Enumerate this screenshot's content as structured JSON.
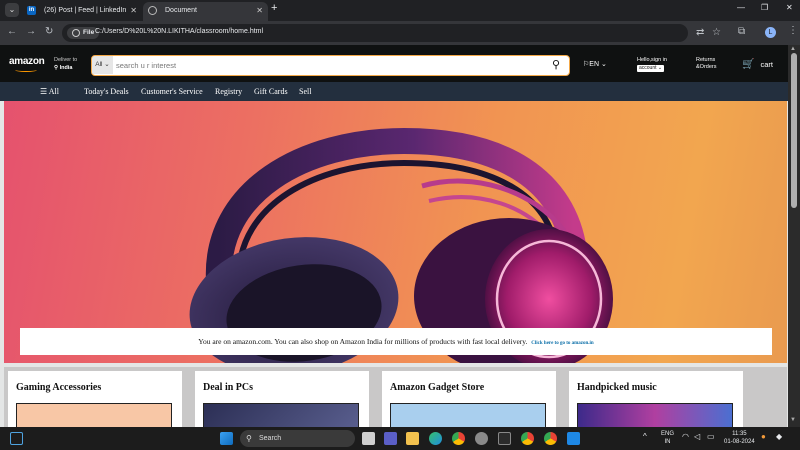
{
  "browser": {
    "tabs": [
      {
        "label": "(26) Post | Feed | LinkedIn",
        "favicon": "linkedin-icon"
      },
      {
        "label": "Document",
        "favicon": "globe-icon",
        "active": true
      }
    ],
    "omnibox": {
      "scheme": "File",
      "url": "C:/Users/D%20L%20N.LIKITHA/classroom/home.html"
    },
    "profile_initial": "L"
  },
  "amazon": {
    "logo": "amazon",
    "deliver": {
      "line1": "Deliver to",
      "line2": "India"
    },
    "search": {
      "category": "All",
      "placeholder": "search u r interest",
      "value": ""
    },
    "language": "EN",
    "account": {
      "line1": "Hello,sign in",
      "select": "account"
    },
    "orders": {
      "line1": "Returns",
      "line2": "&Orders"
    },
    "cart": "cart",
    "subnav": [
      "All",
      "Today's Deals",
      "Customer's Service",
      "Registry",
      "Gift Cards",
      "Sell"
    ],
    "banner": {
      "text": "You are on amazon.com. You can also shop on Amazon India for millions of products with fast local delivery.",
      "link": "Click here to go to amazon.in"
    },
    "cards": [
      {
        "title": "Gaming Accessories",
        "color": "#f8c7a6"
      },
      {
        "title": "Deal in PCs",
        "color": "#39406a"
      },
      {
        "title": "Amazon Gadget Store",
        "color": "#a9cfee"
      },
      {
        "title": "Handpicked music",
        "color": "#6a3fa7"
      }
    ]
  },
  "taskbar": {
    "search": "Search",
    "lang": {
      "line1": "ENG",
      "line2": "IN"
    },
    "time": "11:35",
    "date": "01-08-2024"
  },
  "colors": {
    "accent": "#f3a847",
    "nav_dark": "#0f1111",
    "subnav": "#232f3e"
  }
}
